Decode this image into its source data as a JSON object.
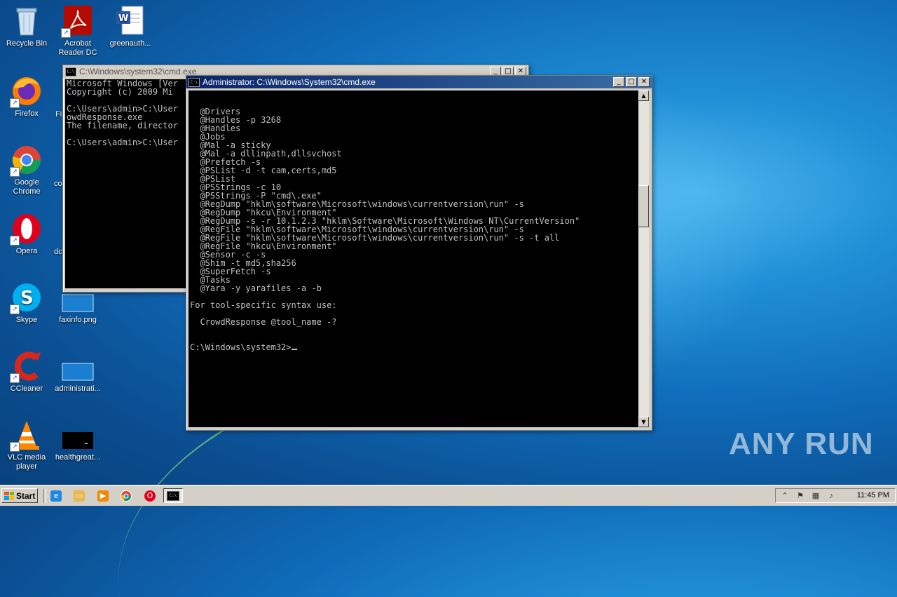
{
  "desktop": {
    "icons": [
      {
        "label": "Recycle Bin"
      },
      {
        "label": "Acrobat Reader DC"
      },
      {
        "label": "greenauth..."
      },
      {
        "label": "Firefox"
      },
      {
        "label": "Google Chrome"
      },
      {
        "label": "Opera"
      },
      {
        "label": "Skype"
      },
      {
        "label": "faxinfo.png"
      },
      {
        "label": "CCleaner"
      },
      {
        "label": "administrati..."
      },
      {
        "label": "VLC media player"
      },
      {
        "label": "healthgreat..."
      }
    ],
    "partial_labels": [
      "Fi",
      "co",
      "dc"
    ]
  },
  "back_window": {
    "title": "C:\\Windows\\system32\\cmd.exe",
    "lines": [
      "Microsoft Windows [Ver",
      "Copyright (c) 2009 Mi",
      "",
      "C:\\Users\\admin>C:\\User",
      "owdResponse.exe",
      "The filename, director",
      "",
      "C:\\Users\\admin>C:\\User"
    ]
  },
  "front_window": {
    "title": "Administrator: C:\\Windows\\System32\\cmd.exe",
    "lines": [
      "  @Drivers",
      "  @Handles -p 3268",
      "  @Handles",
      "  @Jobs",
      "  @Mal -a sticky",
      "  @Mal -a dllinpath,dllsvchost",
      "  @Prefetch -s",
      "  @PSList -d -t cam,certs,md5",
      "  @PSList",
      "  @PSStrings -c 10",
      "  @PSStrings -P \"cmd\\.exe\"",
      "  @RegDump \"hklm\\software\\Microsoft\\windows\\currentversion\\run\" -s",
      "  @RegDump \"hkcu\\Environment\"",
      "  @RegDump -s -r 10.1.2.3 \"hklm\\Software\\Microsoft\\Windows NT\\CurrentVersion\"",
      "  @RegFile \"hklm\\software\\Microsoft\\windows\\currentversion\\run\" -s",
      "  @RegFile \"hklm\\software\\Microsoft\\windows\\currentversion\\run\" -s -t all",
      "  @RegFile \"hkcu\\Environment\"",
      "  @Sensor -c -s",
      "  @Shim -t md5,sha256",
      "  @SuperFetch -s",
      "  @Tasks",
      "  @Yara -y yarafiles -a -b",
      "",
      "For tool-specific syntax use:",
      "",
      "  CrowdResponse @tool_name -?",
      "",
      ""
    ],
    "prompt": "C:\\Windows\\system32>"
  },
  "taskbar": {
    "start_label": "Start",
    "clock": "11:45 PM"
  },
  "watermark": "ANY RUN"
}
